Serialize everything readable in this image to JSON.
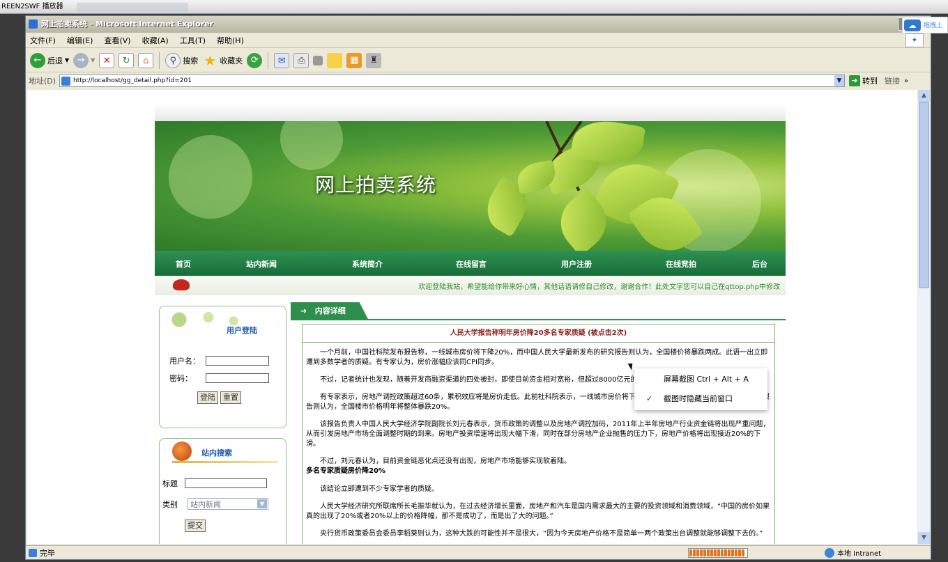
{
  "player": {
    "title": "REEN2SWF 播放器"
  },
  "window": {
    "title": "网上拍卖系统 - Microsoft Internet Explorer",
    "minimize": "_",
    "close": "×"
  },
  "floating_logo": {
    "text": "拖拽上"
  },
  "menubar": {
    "items": [
      "文件(F)",
      "编辑(E)",
      "查看(V)",
      "收藏(A)",
      "工具(T)",
      "帮助(H)"
    ]
  },
  "toolbar": {
    "back": "后退",
    "search": "搜索",
    "favorites": "收藏夹"
  },
  "address": {
    "label": "地址(D)",
    "url": "http://localhost/gg_detail.php?id=201",
    "go": "转到",
    "links": "链接"
  },
  "status": {
    "text": "完毕",
    "zone": "本地 Intranet",
    "progress_percent": 100
  },
  "site": {
    "title": "网上拍卖系统",
    "nav": [
      "首页",
      "站内新闻",
      "系统简介",
      "在线留言",
      "用户注册",
      "在线竞拍",
      "后台"
    ],
    "ticker": "欢迎登陆我站，希望能给你带来好心情，其他话语请修自己修改，谢谢合作！此处文字您可以自己在qttop.php中修改"
  },
  "login": {
    "title": "用户登陆",
    "username_label": "用户名：",
    "password_label": "密码：",
    "login_btn": "登陆",
    "reset_btn": "重置"
  },
  "search": {
    "title": "站内搜索",
    "title_label": "标题",
    "category_label": "类别",
    "category_value": "站内新闻",
    "submit_btn": "提交"
  },
  "content": {
    "tab": "内容详细",
    "article_title": "人民大学报告称明年房价降20多名专家质疑 (被点击2次)",
    "paragraphs": [
      "一个月前，中国社科院发布报告称，一线城市房价将下降20%，而中国人民大学最新发布的研究报告则认为，全国楼价将暴跌两成。此语一出立即遭到多数学者的质疑。有专家认为，房价涨幅应该同CPI同步。",
      "不过，记者统计也发现，随着开发商融资渠道的四处被封，即使目前资金相对宽裕，但超过8000亿元的短期债款将使示威开发商受到威胁。",
      "有专家表示，房地产调控政策超过60条，累积效应将是房价走低。此前社科院表示，一线城市房价将下降20%，而中国人民大学最新发布的研究报告则认为，全国楼市价格明年将整体暴跌20%。",
      "该报告负责人中国人民大学经济学院副院长刘元春表示，货币政策的调整以及房地产调控加码，2011年上半年房地产行业资金链将出现严重问题，从而引发房地产市场全面调整时期的到来。房地产投资增速将出现大幅下滑，同时在部分房地产企业抛售的压力下，房地产价格将出现接近20%的下滑。",
      "不过，刘元春认为，目前资金链恶化点还没有出现，房地产市场能够实现软着陆。",
      "该结论立即遭到不少专家学者的质疑。",
      "人民大学经济研究所联席所长毛振华就认为，在过去经济增长里面，房地产和汽车是国内需求最大的主要的投资领域和消费领域，“中国的房价如果真的出现了20%或者20%以上的价格降幅，那不是成功了，而是出了大的问题。”",
      "央行货币政策委员会委员李稻葵则认为，这种大跌的可能性并不是很大，“因为今天房地产价格不是简单一两个政策出台调整就能够调整下去的。”"
    ],
    "subheading": "多名专家质疑房价降20%"
  },
  "context_menu": {
    "items": [
      "屏幕截图 Ctrl + Alt + A",
      "截图时隐藏当前窗口"
    ],
    "checked": "✓"
  },
  "colors": {
    "nav_green": "#1f7b43",
    "title_red": "#8b1f1f",
    "ticker_green": "#2b8b2b",
    "box_title_blue": "#1b57b0"
  }
}
